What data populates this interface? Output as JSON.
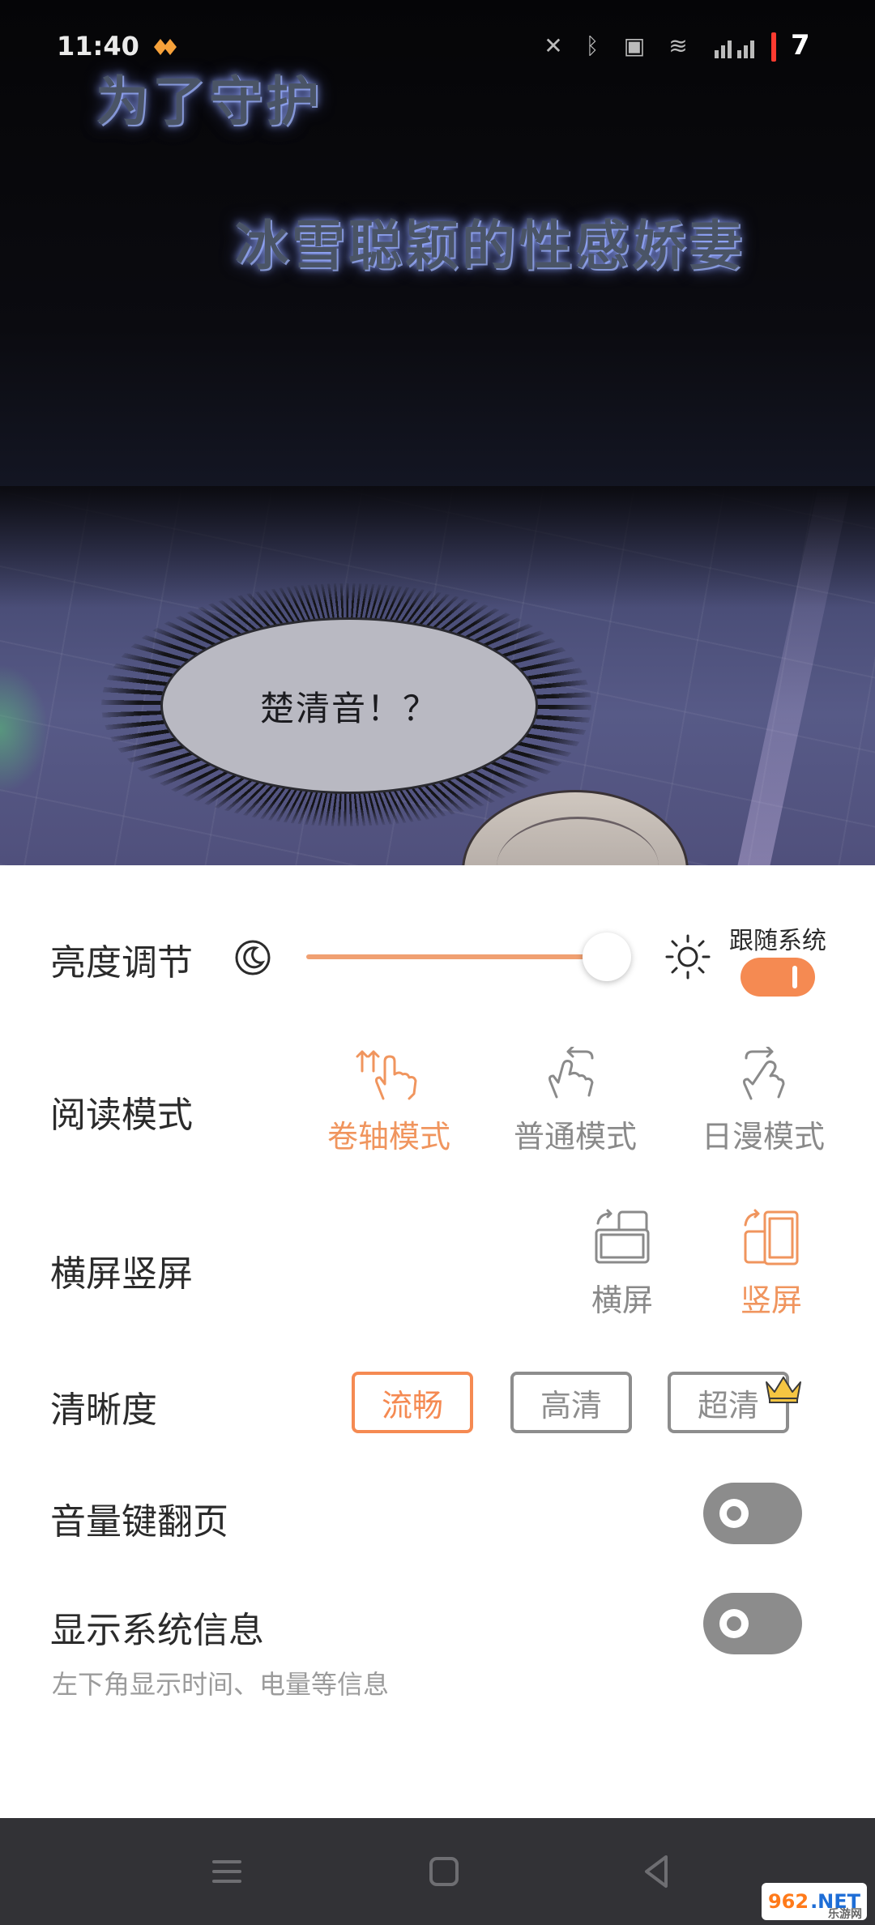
{
  "status_bar": {
    "time": "11:40",
    "battery_level": "7"
  },
  "comic": {
    "caption_1": "为了守护",
    "caption_2": "冰雪聪颖的性感娇妻",
    "speech_bubble": "楚清音！？"
  },
  "settings": {
    "brightness": {
      "label": "亮度调节",
      "level": 0.92,
      "follow_system_label": "跟随系统",
      "follow_system_on": true
    },
    "reading_mode": {
      "label": "阅读模式",
      "options": [
        {
          "label": "卷轴模式",
          "icon": "scroll-swipe-up-icon",
          "active": true
        },
        {
          "label": "普通模式",
          "icon": "swipe-left-icon",
          "active": false
        },
        {
          "label": "日漫模式",
          "icon": "swipe-right-icon",
          "active": false
        }
      ]
    },
    "orientation": {
      "label": "横屏竖屏",
      "options": [
        {
          "label": "横屏",
          "icon": "landscape-rotate-icon",
          "active": false
        },
        {
          "label": "竖屏",
          "icon": "portrait-rotate-icon",
          "active": true
        }
      ]
    },
    "clarity": {
      "label": "清晰度",
      "options": [
        {
          "label": "流畅",
          "active": true
        },
        {
          "label": "高清",
          "active": false
        },
        {
          "label": "超清",
          "active": false,
          "vip": true
        }
      ]
    },
    "volume_key_turn_page": {
      "label": "音量键翻页",
      "on": false
    },
    "show_system_info": {
      "label": "显示系统信息",
      "hint": "左下角显示时间、电量等信息",
      "on": false
    }
  },
  "watermark": {
    "brand": "962",
    "suffix": ".NET",
    "sub": "乐游网"
  },
  "colors": {
    "accent": "#f58a52",
    "inactive": "#8d8d8d",
    "panel_bg": "#ffffff",
    "navbar_bg": "#323236"
  }
}
